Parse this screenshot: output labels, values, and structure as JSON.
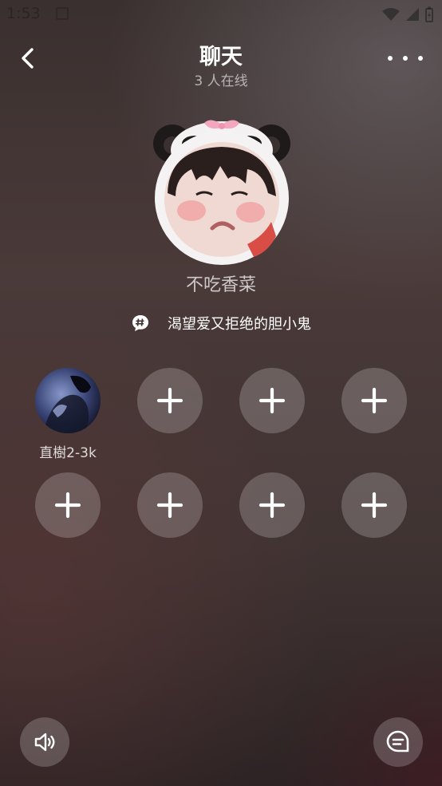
{
  "status_bar": {
    "time": "1:53",
    "icons": [
      "notification-icon",
      "wifi-icon",
      "signal-icon",
      "battery-icon"
    ]
  },
  "header": {
    "title": "聊天",
    "online_count": "3 人在线",
    "back_icon": "chevron-left-icon",
    "more_icon": "more-dots-icon"
  },
  "host": {
    "name": "不吃香菜",
    "avatar": "panda-frame-avatar"
  },
  "topic": {
    "icon": "hashtag-bubble-icon",
    "text": "渴望爱又拒绝的胆小鬼"
  },
  "seats": [
    {
      "occupied": true,
      "name": "直樹2-3k"
    },
    {
      "occupied": false,
      "icon": "plus-icon"
    },
    {
      "occupied": false,
      "icon": "plus-icon"
    },
    {
      "occupied": false,
      "icon": "plus-icon"
    },
    {
      "occupied": false,
      "icon": "plus-icon"
    },
    {
      "occupied": false,
      "icon": "plus-icon"
    },
    {
      "occupied": false,
      "icon": "plus-icon"
    },
    {
      "occupied": false,
      "icon": "plus-icon"
    }
  ],
  "footer": {
    "speaker_icon": "speaker-icon",
    "chat_icon": "chat-bubble-icon"
  },
  "colors": {
    "accent": "#ffffff",
    "seat_bg": "rgba(255,255,255,0.2)"
  }
}
